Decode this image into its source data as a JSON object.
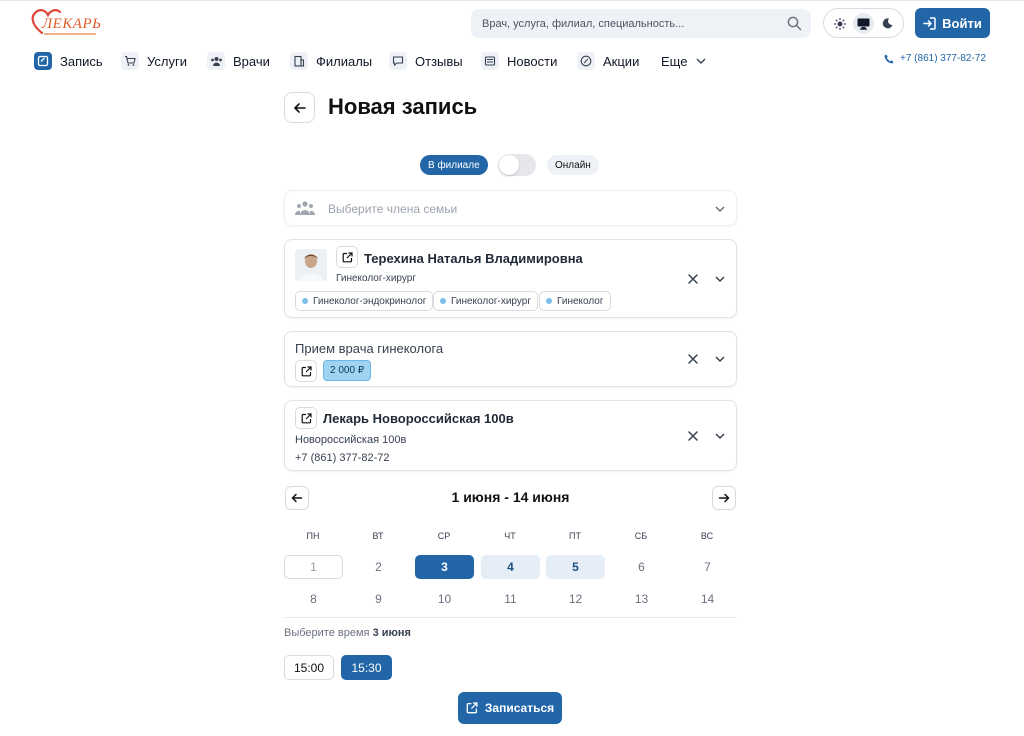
{
  "header": {
    "logo_text": "ЛЕКАРЬ",
    "search_placeholder": "Врач, услуга, филиал, специальность...",
    "login_label": "Войти",
    "brand_color": "#2266a8"
  },
  "nav": {
    "items": [
      {
        "label": "Запись",
        "icon": "appointment-icon"
      },
      {
        "label": "Услуги",
        "icon": "cart-icon"
      },
      {
        "label": "Врачи",
        "icon": "doctors-icon"
      },
      {
        "label": "Филиалы",
        "icon": "building-icon"
      },
      {
        "label": "Отзывы",
        "icon": "chat-icon"
      },
      {
        "label": "Новости",
        "icon": "newspaper-icon"
      },
      {
        "label": "Акции",
        "icon": "percent-icon"
      },
      {
        "label": "Еще",
        "icon": "chevron-down-icon"
      }
    ],
    "phone": "+7 (861) 377-82-72"
  },
  "page": {
    "title": "Новая запись",
    "mode_offline": "В филиале",
    "mode_online": "Онлайн",
    "family_placeholder": "Выберите члена семьи"
  },
  "doctor": {
    "name": "Терехина Наталья Владимировна",
    "role": "Гинеколог-хирург",
    "tags": [
      "Гинеколог-эндокринолог",
      "Гинеколог-хирург",
      "Гинеколог"
    ]
  },
  "service": {
    "name": "Прием врача гинеколога",
    "price": "2 000 ₽"
  },
  "branch": {
    "name": "Лекарь Новороссийская 100в",
    "address": "Новороссийская 100в",
    "phone": "+7 (861) 377-82-72"
  },
  "calendar": {
    "range": "1 июня - 14 июня",
    "weekdays": [
      "ПН",
      "ВТ",
      "СР",
      "ЧТ",
      "ПТ",
      "СБ",
      "ВС"
    ],
    "week1": [
      "1",
      "2",
      "3",
      "4",
      "5",
      "6",
      "7"
    ],
    "week2": [
      "8",
      "9",
      "10",
      "11",
      "12",
      "13",
      "14"
    ],
    "selected_day": "3",
    "available_days": [
      "3",
      "4",
      "5"
    ]
  },
  "time": {
    "hint_prefix": "Выберите время",
    "hint_date": "3 июня",
    "slots": [
      "15:00",
      "15:30"
    ],
    "selected_slot": "15:30"
  },
  "submit_label": "Записаться"
}
